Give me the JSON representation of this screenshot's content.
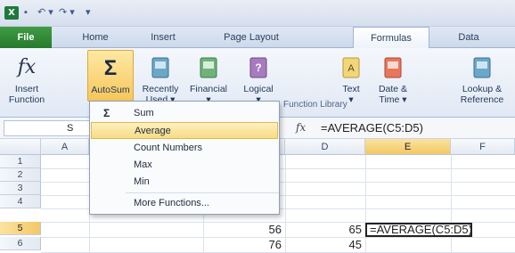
{
  "quick_access": {
    "logo": "X",
    "save_glyph": "▪",
    "undo_glyph": "↶ ▾",
    "redo_glyph": "↷ ▾",
    "more_glyph": "▾"
  },
  "tabs": [
    "File",
    "Home",
    "Insert",
    "Page Layout",
    "Formulas",
    "Data"
  ],
  "ribbon": {
    "insert_function": {
      "icon_text": "fx",
      "label1": "Insert",
      "label2": "Function"
    },
    "autosum": {
      "icon_text": "Σ",
      "label": "AutoSum"
    },
    "recently_used": {
      "label1": "Recently",
      "label2": "Used ▾"
    },
    "financial": {
      "label1": "Financial",
      "label2": "▾"
    },
    "logical": {
      "label1": "Logical",
      "label2": "▾"
    },
    "text": {
      "label1": "Text",
      "label2": "▾"
    },
    "date_time": {
      "label1": "Date &",
      "label2": "Time ▾"
    },
    "lookup": {
      "label1": "Lookup &",
      "label2": "Reference"
    },
    "group_label": "Function Library"
  },
  "formula_bar": {
    "name_box": "S",
    "fx": "fx",
    "formula": "=AVERAGE(C5:D5)"
  },
  "columns": [
    "A",
    "D",
    "E",
    "F"
  ],
  "rows": [
    "1",
    "2",
    "3",
    "4",
    "5",
    "6"
  ],
  "cells": {
    "C5": "56",
    "D5": "65",
    "C6": "76",
    "D6": "45",
    "E5": "=AVERAGE(C5:D5)"
  },
  "menu": {
    "items": [
      "Sum",
      "Average",
      "Count Numbers",
      "Max",
      "Min",
      "More Functions..."
    ],
    "sum_icon": "Σ"
  },
  "colors": {
    "file_tab": "#267a2d",
    "highlight": "#f8dc84",
    "active_formula_tab": "#ffffff"
  }
}
